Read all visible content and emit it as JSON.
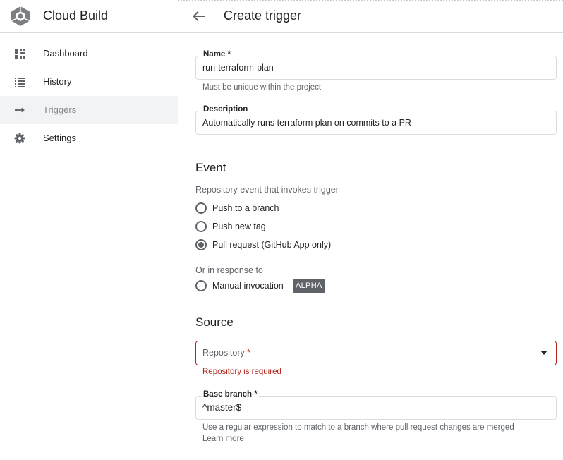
{
  "app": {
    "title": "Cloud Build"
  },
  "sidebar": {
    "items": [
      {
        "label": "Dashboard",
        "icon": "dashboard-icon",
        "active": false
      },
      {
        "label": "History",
        "icon": "list-icon",
        "active": false
      },
      {
        "label": "Triggers",
        "icon": "triggers-icon",
        "active": true
      },
      {
        "label": "Settings",
        "icon": "gear-icon",
        "active": false
      }
    ]
  },
  "header": {
    "title": "Create trigger",
    "back_icon": "arrow-back-icon"
  },
  "form": {
    "name": {
      "label": "Name *",
      "value": "run-terraform-plan",
      "hint": "Must be unique within the project"
    },
    "description": {
      "label": "Description",
      "value": "Automatically runs terraform plan on commits to a PR"
    },
    "event": {
      "title": "Event",
      "subtitle": "Repository event that invokes trigger",
      "options": [
        {
          "label": "Push to a branch",
          "checked": false
        },
        {
          "label": "Push new tag",
          "checked": false
        },
        {
          "label": "Pull request (GitHub App only)",
          "checked": true
        }
      ],
      "alt_subtitle": "Or in response to",
      "manual": {
        "label": "Manual invocation",
        "checked": false,
        "badge": "ALPHA"
      }
    },
    "source": {
      "title": "Source",
      "repository": {
        "placeholder": "Repository",
        "required_mark": "*",
        "error": "Repository is required"
      },
      "base_branch": {
        "label": "Base branch *",
        "value": "^master$",
        "hint": "Use a regular expression to match to a branch where pull request changes are merged",
        "learn_more": "Learn more"
      }
    }
  },
  "colors": {
    "error": "#b3261e",
    "active_nav_bg": "#f1f3f4",
    "border": "#dadce0"
  }
}
